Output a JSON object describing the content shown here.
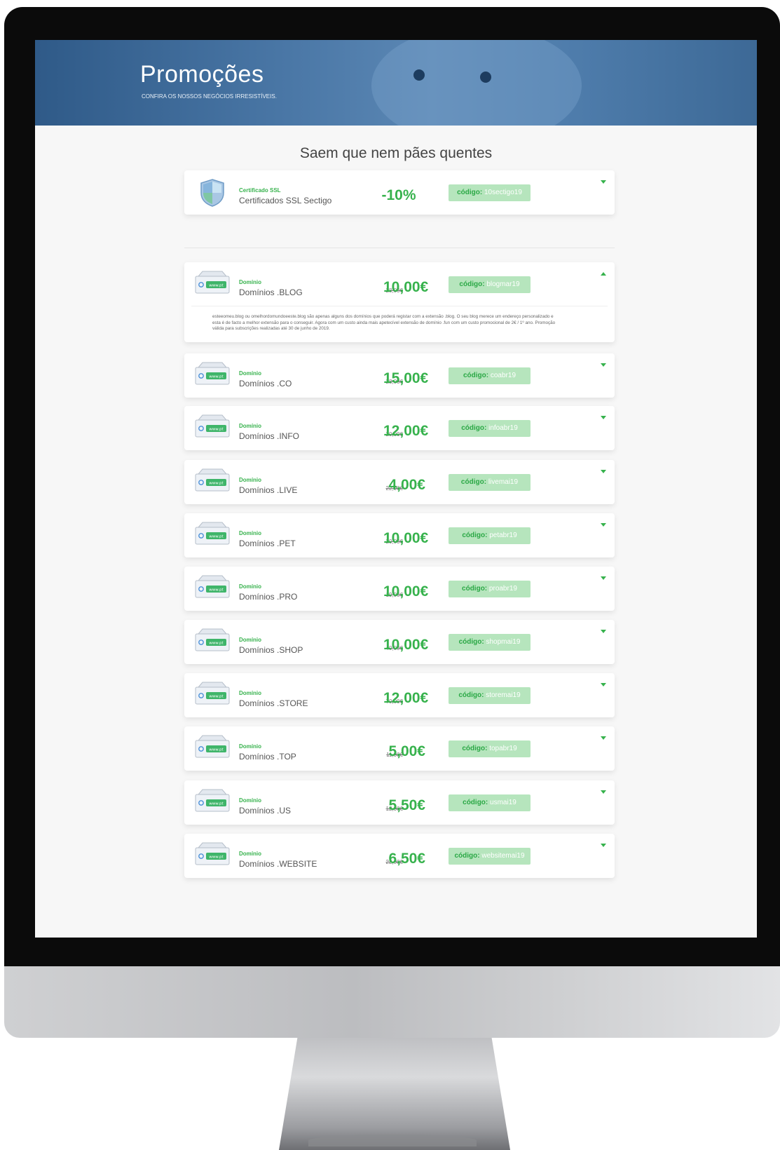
{
  "banner": {
    "title": "Promoções",
    "subtitle": "CONFIRA OS NOSSOS NEGÓCIOS IRRESISTÍVEIS."
  },
  "section": {
    "title": "Saem que nem pães quentes"
  },
  "code_prefix": "código:",
  "colors": {
    "accent_green": "#37b24d",
    "badge_green": "#b6e5bd",
    "banner_blue": "#3d6996"
  },
  "promos": [
    {
      "icon": "shield-icon",
      "category": "Certificado SSL",
      "name": "Certificados SSL Sectigo",
      "price_old": "",
      "price_new": "-10%",
      "code": "10sectigo19",
      "expanded": false,
      "description": ""
    },
    {
      "icon": "domain-icon",
      "category": "Domínio",
      "name": "Domínios .BLOG",
      "price_old": "28,00€",
      "price_new": "10,00€",
      "code": "blogmar19",
      "expanded": true,
      "description": "esteeomeu.blog ou omelhordomundoeeste.blog são apenas alguns dos domínios que poderá registar com a extensão .blog. O seu blog merece um endereço personalizado e esta é de facto a melhor extensão para o conseguir. Agora com um custo ainda mais apetecível extensão de domínio .fun com um custo promocional de 2€ / 1º ano. Promoção válida para subscrições realizadas até 30 de junho de 2019."
    },
    {
      "icon": "domain-icon",
      "category": "Domínio",
      "name": "Domínios .CO",
      "price_old": "28,00€",
      "price_new": "15,00€",
      "code": "coabr19",
      "expanded": false,
      "description": ""
    },
    {
      "icon": "domain-icon",
      "category": "Domínio",
      "name": "Domínios .INFO",
      "price_old": "20,00€",
      "price_new": "12,00€",
      "code": "infoabr19",
      "expanded": false,
      "description": ""
    },
    {
      "icon": "domain-icon",
      "category": "Domínio",
      "name": "Domínios .LIVE",
      "price_old": "22,00€",
      "price_new": "4,00€",
      "code": "livemai19",
      "expanded": false,
      "description": ""
    },
    {
      "icon": "domain-icon",
      "category": "Domínio",
      "name": "Domínios .PET",
      "price_old": "20,00€",
      "price_new": "10,00€",
      "code": "petabr19",
      "expanded": false,
      "description": ""
    },
    {
      "icon": "domain-icon",
      "category": "Domínio",
      "name": "Domínios .PRO",
      "price_old": "19,00€",
      "price_new": "10,00€",
      "code": "proabr19",
      "expanded": false,
      "description": ""
    },
    {
      "icon": "domain-icon",
      "category": "Domínio",
      "name": "Domínios .SHOP",
      "price_old": "40,00€",
      "price_new": "10,00€",
      "code": "shopmai19",
      "expanded": false,
      "description": ""
    },
    {
      "icon": "domain-icon",
      "category": "Domínio",
      "name": "Domínios .STORE",
      "price_old": "70,00€",
      "price_new": "12,00€",
      "code": "storemai19",
      "expanded": false,
      "description": ""
    },
    {
      "icon": "domain-icon",
      "category": "Domínio",
      "name": "Domínios .TOP",
      "price_old": "11,00€",
      "price_new": "5,00€",
      "code": "topabr19",
      "expanded": false,
      "description": ""
    },
    {
      "icon": "domain-icon",
      "category": "Domínio",
      "name": "Domínios .US",
      "price_old": "12,00€",
      "price_new": "5,50€",
      "code": "usmai19",
      "expanded": false,
      "description": ""
    },
    {
      "icon": "domain-icon",
      "category": "Domínio",
      "name": "Domínios .WEBSITE",
      "price_old": "22,00€",
      "price_new": "6,50€",
      "code": "websitemai19",
      "expanded": false,
      "description": ""
    }
  ]
}
